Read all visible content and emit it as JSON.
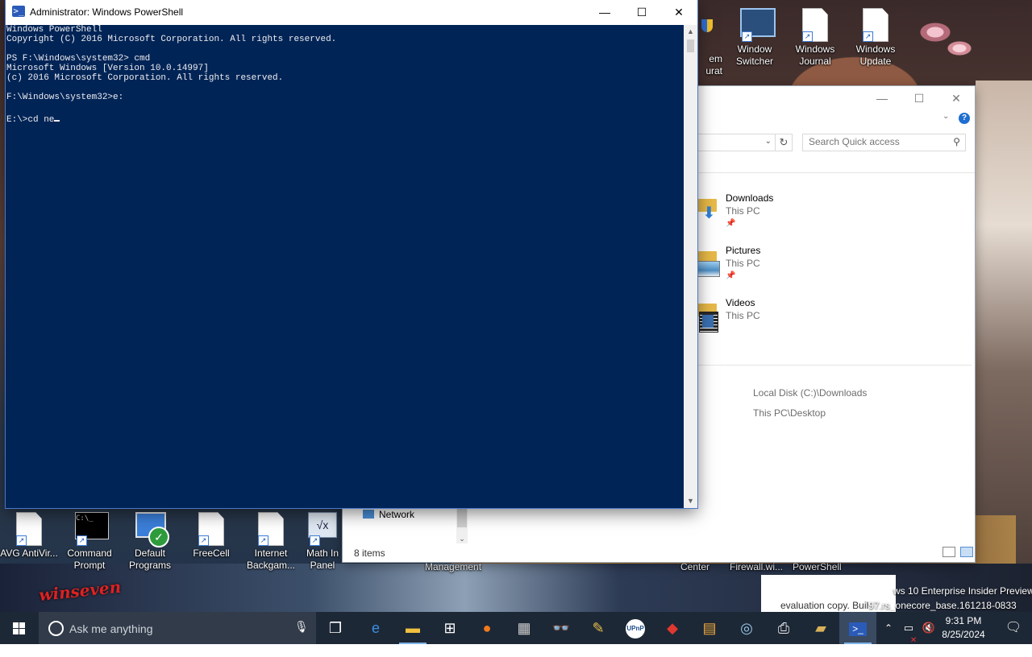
{
  "powershell": {
    "title": "Administrator: Windows PowerShell",
    "lines": [
      "Windows PowerShell",
      "Copyright (C) 2016 Microsoft Corporation. All rights reserved.",
      "",
      "PS F:\\Windows\\system32> cmd",
      "Microsoft Windows [Version 10.0.14997]",
      "(c) 2016 Microsoft Corporation. All rights reserved.",
      "",
      "F:\\Windows\\system32>e:",
      ""
    ],
    "current_line": "E:\\>cd ne",
    "controls": {
      "minimize": "—",
      "maximize": "☐",
      "close": "✕"
    }
  },
  "explorer": {
    "search_placeholder": "Search Quick access",
    "quick_access": [
      {
        "name": "Downloads",
        "location": "This PC",
        "pinned": true
      },
      {
        "name": "Pictures",
        "location": "This PC",
        "pinned": true
      },
      {
        "name": "Videos",
        "location": "This PC",
        "pinned": false
      }
    ],
    "recent": [
      "Local Disk (C:)\\Downloads",
      "This PC\\Desktop"
    ],
    "nav_item": "Network",
    "status": "8 items"
  },
  "desktop_icons_top": [
    {
      "label": "Window Switcher"
    },
    {
      "label": "Windows Journal"
    },
    {
      "label": "Windows Update"
    }
  ],
  "desktop_partial_top": {
    "line1": "em",
    "line2": "urat"
  },
  "desktop_icons_bottom": [
    {
      "label": "AVG AntiVir..."
    },
    {
      "label": "Command Prompt"
    },
    {
      "label": "Default Programs"
    },
    {
      "label": "FreeCell"
    },
    {
      "label": "Internet Backgam..."
    },
    {
      "label": "Math In Panel"
    }
  ],
  "desktop_words": {
    "management": "Management",
    "center": "Center",
    "firewall": "Firewall.wi...",
    "powershell": "PowerShell"
  },
  "watermark": {
    "line1": "ws 10 Enterprise Insider Preview",
    "line2_dark": "evaluation copy. Buil",
    "line2_light": "97.rs_onecore_base.161218-0833"
  },
  "logo_text": "winseven",
  "taskbar": {
    "search_placeholder": "Ask me anything",
    "apps": [
      "task-view",
      "edge",
      "file-explorer",
      "store",
      "firefox",
      "calculator",
      "binoculars",
      "tool",
      "upnp",
      "red-app",
      "notes",
      "network-app",
      "printer",
      "briefcase",
      "powershell"
    ],
    "time": "9:31 PM",
    "date": "8/25/2024"
  }
}
